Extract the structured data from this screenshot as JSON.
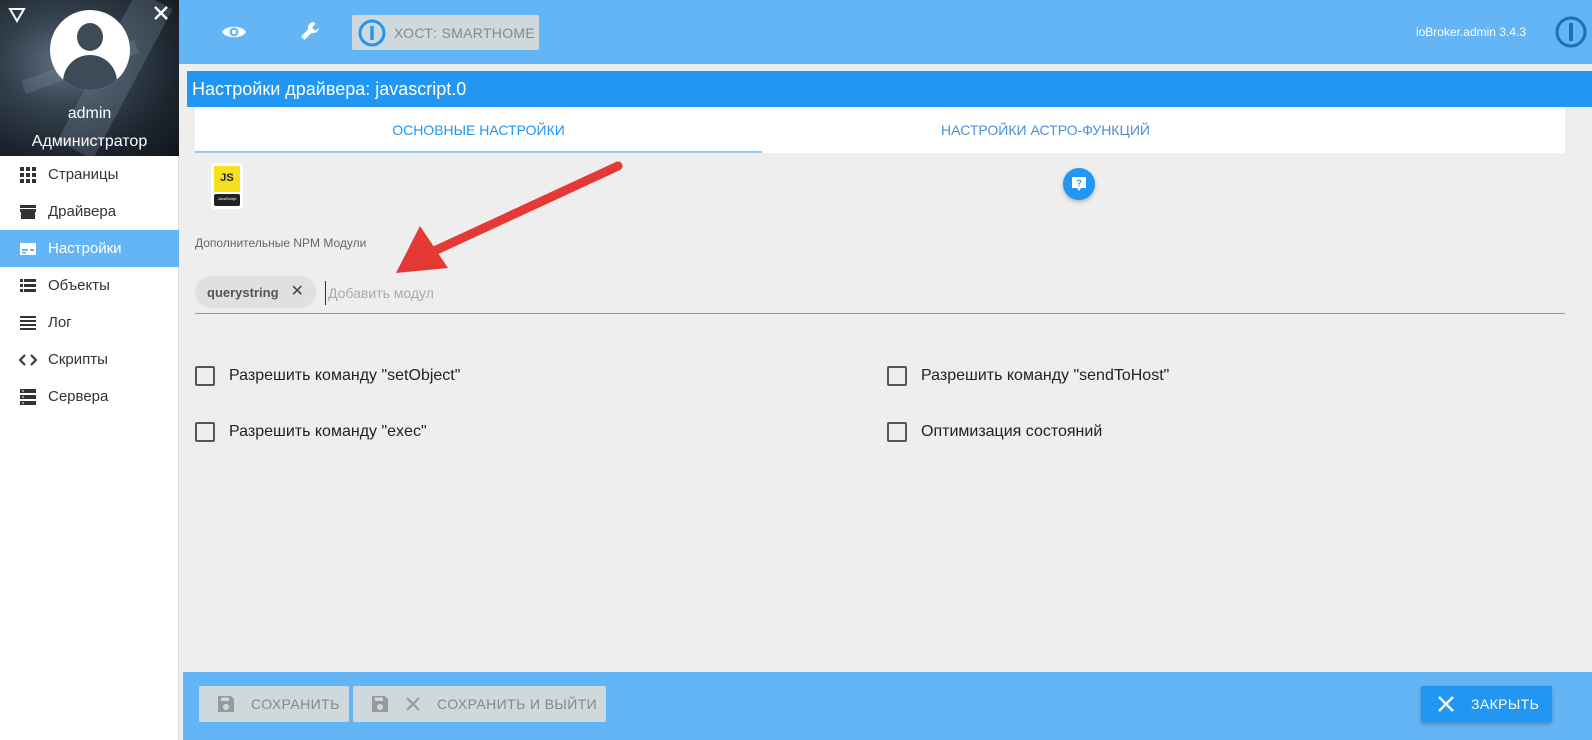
{
  "sidebar": {
    "user_name": "admin",
    "user_role": "Администратор",
    "items": [
      {
        "label": "Страницы",
        "icon": "grid-icon"
      },
      {
        "label": "Драйвера",
        "icon": "store-icon"
      },
      {
        "label": "Настройки",
        "icon": "settings-panel-icon",
        "active": true
      },
      {
        "label": "Объекты",
        "icon": "list-icon"
      },
      {
        "label": "Лог",
        "icon": "lines-icon"
      },
      {
        "label": "Скрипты",
        "icon": "code-icon"
      },
      {
        "label": "Сервера",
        "icon": "server-icon"
      }
    ]
  },
  "topbar": {
    "host_label": "ХОСТ: SMARTHOME",
    "version": "ioBroker.admin 3.4.3"
  },
  "dialog": {
    "title": "Настройки драйвера: javascript.0",
    "tabs": [
      {
        "label": "ОСНОВНЫЕ НАСТРОЙКИ",
        "active": true
      },
      {
        "label": "НАСТРОЙКИ АСТРО-ФУНКЦИЙ",
        "active": false
      }
    ],
    "logo_text": "JS",
    "logo_caption": "JavaScript",
    "npm_label": "Дополнительные NPM Модули",
    "npm_chips": [
      "querystring"
    ],
    "npm_placeholder": "Добавить модул",
    "checkboxes": {
      "setobject": {
        "label": "Разрешить команду \"setObject\"",
        "checked": false
      },
      "exec": {
        "label": "Разрешить команду \"exec\"",
        "checked": false
      },
      "sendtohost": {
        "label": "Разрешить команду \"sendToHost\"",
        "checked": false
      },
      "optimize": {
        "label": "Оптимизация состояний",
        "checked": false
      }
    }
  },
  "footer": {
    "save_label": "СОХРАНИТЬ",
    "save_exit_label": "СОХРАНИТЬ И ВЫЙТИ",
    "close_label": "ЗАКРЫТЬ"
  },
  "colors": {
    "primary": "#2196f3",
    "bar": "#64b5f6",
    "annotation": "#e53935"
  }
}
